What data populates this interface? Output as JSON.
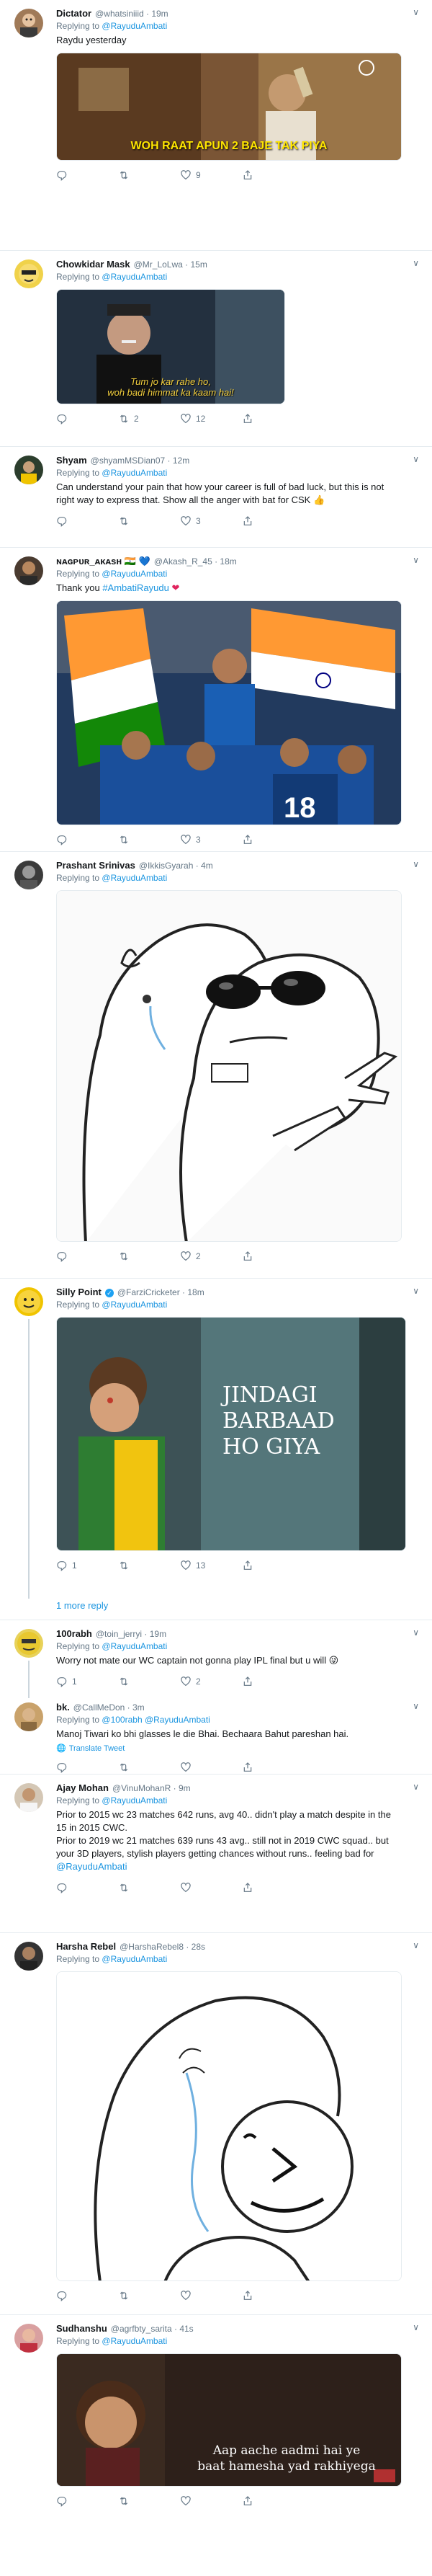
{
  "replying_label": "Replying to",
  "more_replies_label": "1 more reply",
  "translate_label": "Translate Tweet",
  "tweets": [
    {
      "name": "Dictator",
      "handle": "@whatsiniiid · 19m",
      "reply_to": "@RayuduAmbati",
      "text": "Raydu yesterday",
      "media_caption": "WOH RAAT APUN 2 BAJE TAK PIYA",
      "reply_count": "",
      "retweet_count": "",
      "like_count": "9"
    },
    {
      "name": "Chowkidar Mask",
      "handle": "@Mr_LoLwa · 15m",
      "reply_to": "@RayuduAmbati",
      "text": "",
      "media_caption": "Tum jo kar rahe ho,\nwoh badi himmat ka kaam hai!",
      "reply_count": "",
      "retweet_count": "2",
      "like_count": "12"
    },
    {
      "name": "Shyam",
      "handle": "@shyamMSDian07 · 12m",
      "reply_to": "@RayuduAmbati",
      "text": "Can understand your pain that how your career is full of bad luck, but this is not right way to express that. Show all the anger with bat for CSK 👍",
      "reply_count": "",
      "retweet_count": "",
      "like_count": "3"
    },
    {
      "name": "ɴᴀɢᴘᴜʀ_ᴀᴋᴀsʜ 🇮🇳 💙",
      "handle": "@Akash_R_45 · 18m",
      "reply_to": "@RayuduAmbati",
      "text": "Thank you",
      "hashtag": "#AmbatiRayudu",
      "reply_count": "",
      "retweet_count": "",
      "like_count": "3",
      "jersey": "18"
    },
    {
      "name": "Prashant Srinivas",
      "handle": "@IkkisGyarah · 4m",
      "reply_to": "@RayuduAmbati",
      "text": "",
      "reply_count": "",
      "retweet_count": "",
      "like_count": "2"
    },
    {
      "name": "Silly Point",
      "handle": "@FarziCricketer · 18m",
      "reply_to": "@RayuduAmbati",
      "text": "",
      "media_caption": "JINDAGI\nBARBAAD\nHO GIYA",
      "reply_count": "1",
      "retweet_count": "",
      "like_count": "13"
    },
    {
      "name": "100rabh",
      "handle": "@toin_jerryi · 19m",
      "reply_to": "@RayuduAmbati",
      "text": "Worry not mate our WC captain not gonna play IPL final but u will 😜",
      "reply_count": "1",
      "retweet_count": "",
      "like_count": "2"
    },
    {
      "name": "bk.",
      "handle": "@CallMeDon · 3m",
      "reply_to": "@100rabh @RayuduAmbati",
      "text": "Manoj Tiwari ko bhi glasses le die Bhai. Bechaara Bahut pareshan hai.",
      "reply_count": "",
      "retweet_count": "",
      "like_count": ""
    },
    {
      "name": "Ajay Mohan",
      "handle": "@VinuMohanR · 9m",
      "reply_to": "@RayuduAmbati",
      "text_lines": [
        "Prior to 2015 wc 23 matches 642 runs, avg 40.. didn't play a match despite in the 15 in 2015 CWC.",
        "Prior to 2019 wc 21 matches 639 runs 43 avg.. still not in 2019 CWC squad.. but your 3D players, stylish players getting chances without runs.. feeling bad for"
      ],
      "mention": "@RayuduAmbati",
      "reply_count": "",
      "retweet_count": "",
      "like_count": ""
    },
    {
      "name": "Harsha Rebel",
      "handle": "@HarshaRebel8 · 28s",
      "reply_to": "@RayuduAmbati",
      "text": "",
      "reply_count": "",
      "retweet_count": "",
      "like_count": ""
    },
    {
      "name": "Sudhanshu",
      "handle": "@agrfbty_sarita · 41s",
      "reply_to": "@RayuduAmbati",
      "text": "",
      "media_caption": "Aap aache aadmi hai ye\nbaat hamesha yad rakhiyega",
      "reply_count": "",
      "retweet_count": "",
      "like_count": ""
    }
  ],
  "icons": {
    "reply": "reply-icon",
    "retweet": "retweet-icon",
    "like": "heart-icon",
    "share": "share-icon",
    "caret": "chevron-down-icon",
    "verified": "verified-badge-icon"
  },
  "colors": {
    "link": "#1b95e0",
    "muted": "#657786",
    "divider": "#e6ecf0"
  }
}
